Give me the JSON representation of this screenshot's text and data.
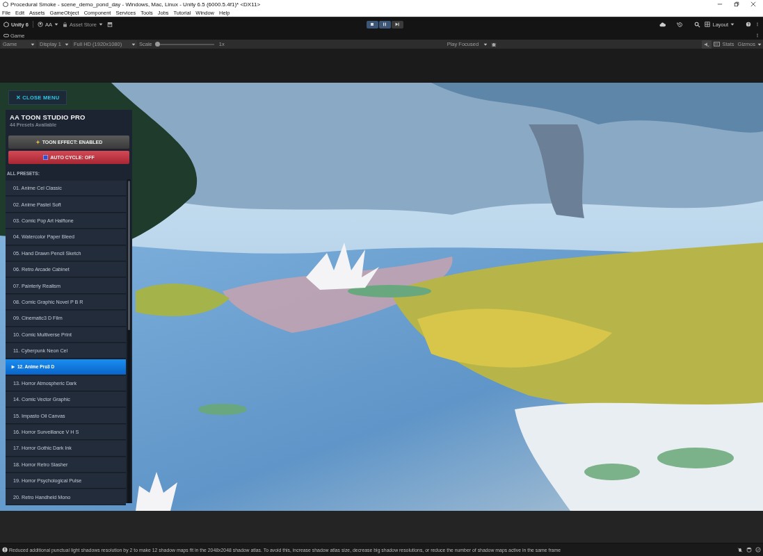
{
  "window": {
    "title": "Procedural Smoke - scene_demo_pond_day - Windows, Mac, Linux - Unity 6.5 (6000.5.4f1)* <DX11>"
  },
  "menu_bar": [
    "File",
    "Edit",
    "Assets",
    "GameObject",
    "Component",
    "Services",
    "Tools",
    "Jobs",
    "Tutorial",
    "Window",
    "Help"
  ],
  "toolbar": {
    "account": "Unity 6",
    "user": "AA",
    "asset_store": "Asset Store",
    "layout": "Layout",
    "play_controls": [
      {
        "kind": "play",
        "on": true
      },
      {
        "kind": "pause",
        "on": true
      },
      {
        "kind": "step",
        "on": false
      }
    ]
  },
  "tab": {
    "label": "Game"
  },
  "game_bar": {
    "view": "Game",
    "display": "Display 1",
    "resolution": "Full HD (1920x1080)",
    "scale_label": "Scale",
    "scale": {
      "level": 0
    },
    "scale_value": "1x",
    "play_mode": "Play Focused",
    "stats": "Stats",
    "gizmos": "Gizmos"
  },
  "menu": {
    "close": "✕ CLOSE MENU",
    "title": "AA TOON STUDIO PRO",
    "subtitle": "44 Presets Available",
    "toggles": [
      {
        "label": "TOON EFFECT: ENABLED",
        "on": true
      },
      {
        "label": "AUTO CYCLE: OFF",
        "on": false
      }
    ],
    "section": "ALL PRESETS:",
    "presets": [
      {
        "label": "01. Anime Cel Classic",
        "selected": false
      },
      {
        "label": "02. Anime Pastel Soft",
        "selected": false
      },
      {
        "label": "03. Comic Pop Art Halftone",
        "selected": false
      },
      {
        "label": "04. Watercolor Paper Bleed",
        "selected": false
      },
      {
        "label": "05. Hand Drawn Pencil Sketch",
        "selected": false
      },
      {
        "label": "06. Retro Arcade Cabinet",
        "selected": false
      },
      {
        "label": "07. Painterly Realism",
        "selected": false
      },
      {
        "label": "08. Comic Graphic Novel P B R",
        "selected": false
      },
      {
        "label": "09. Cinematic3 D Film",
        "selected": false
      },
      {
        "label": "10. Comic Multiverse Print",
        "selected": false
      },
      {
        "label": "11. Cyberpunk Neon Cel",
        "selected": false
      },
      {
        "label": "12. Anime Pro3 D",
        "selected": true
      },
      {
        "label": "13. Horror Atmospheric Dark",
        "selected": false
      },
      {
        "label": "14. Comic Vector Graphic",
        "selected": false
      },
      {
        "label": "15. Impasto Oil Canvas",
        "selected": false
      },
      {
        "label": "16. Horror Surveillance V H S",
        "selected": false
      },
      {
        "label": "17. Horror Gothic Dark Ink",
        "selected": false
      },
      {
        "label": "18. Horror Retro Slasher",
        "selected": false
      },
      {
        "label": "19. Horror Psychological Pulse",
        "selected": false
      },
      {
        "label": "20. Retro Handheld Mono",
        "selected": false
      }
    ]
  },
  "status_bar": {
    "message": "Reduced additional punctual light shadows resolution by 2 to make 12 shadow maps fit in the 2048x2048 shadow atlas. To avoid this, increase shadow atlas size, decrease big shadow resolutions, or reduce the number of shadow maps active in the same frame"
  }
}
